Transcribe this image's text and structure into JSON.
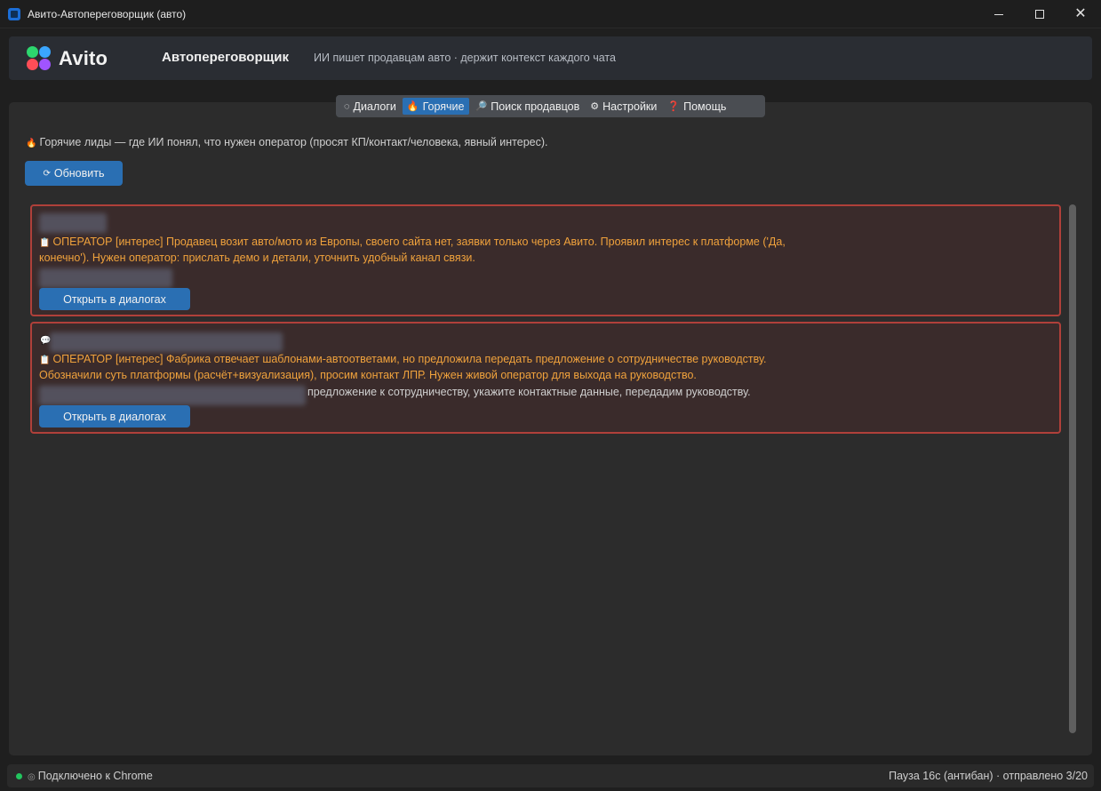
{
  "window": {
    "title": "Авито-Автопереговорщик (авто)",
    "controls": {
      "minimize": "minimize-icon",
      "maximize": "maximize-icon",
      "close": "✕"
    }
  },
  "header": {
    "logo_text": "Avito",
    "app_name": "Автопереговорщик",
    "subtitle": "ИИ пишет продавцам авто · держит контекст каждого чата"
  },
  "tabs": [
    {
      "icon": "◌",
      "label": "Диалоги",
      "active": false
    },
    {
      "icon": "🔥",
      "label": "Горячие",
      "active": true
    },
    {
      "icon": "🔎",
      "label": "Поиск продавцов",
      "active": false
    },
    {
      "icon": "⚙",
      "label": "Настройки",
      "active": false
    },
    {
      "icon": "❓",
      "label": "Помощь",
      "active": false
    }
  ],
  "main": {
    "hint_icon": "🔥",
    "hint": "Горячие лиды — где ИИ понял, что нужен оператор (просят КП/контакт/человека, явный интерес).",
    "refresh_icon": "⟳",
    "refresh_label": "Обновить"
  },
  "leads": [
    {
      "op_icon": "📋",
      "op_text": "ОПЕРАТОР [интерес] Продавец возит авто/мото из Европы, своего сайта нет, заявки только через Авито. Проявил интерес к платформе ('Да, конечно'). Нужен оператор: прислать демо и детали, уточнить удобный канал связи.",
      "open_label": "Открыть в диалогах"
    },
    {
      "op_icon": "📋",
      "op_text": "ОПЕРАТОР [интерес] Фабрика отвечает шаблонами-автоответами, но предложила передать предложение о сотрудничестве руководству. Обозначили суть платформы (расчёт+визуализация), просим контакт ЛПР. Нужен живой оператор для выхода на руководство.",
      "last_message": "предложение к сотрудничеству, укажите контактные данные, передадим руководству.",
      "open_label": "Открыть в диалогах"
    }
  ],
  "status": {
    "dot_color": "#22c55e",
    "connection_icon": "◎",
    "connection": "Подключено к Chrome",
    "right": "Пауза 16с (антибан) · отправлено 3/20"
  },
  "colors": {
    "accent": "#2a6fb3",
    "lead_border": "#b0403a",
    "lead_text": "#f0a23c"
  }
}
